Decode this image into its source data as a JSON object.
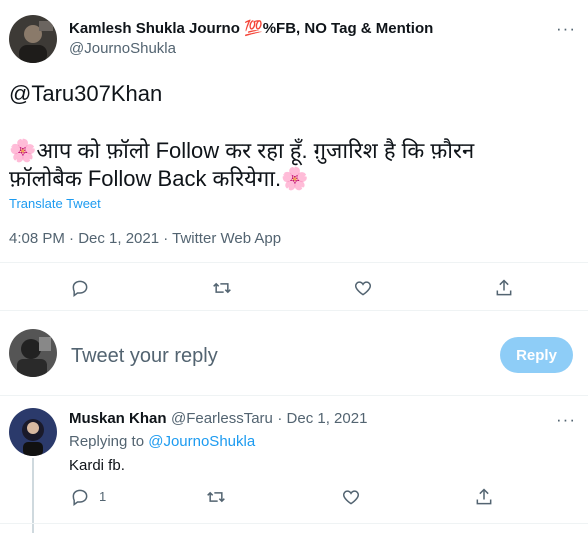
{
  "tweet": {
    "author_name": "Kamlesh Shukla Journo 💯%FB, NO Tag & Mention",
    "author_handle": "@JournoShukla",
    "more_label": "···",
    "mention": "@Taru307Khan",
    "line1": "🌸आप को फ़ॉलो Follow कर रहा हूँ. ग़ुजारिश है कि फ़ौरन",
    "line2": "फ़ॉलोबैक Follow Back करियेगा.🌸",
    "translate_label": "Translate Tweet",
    "timestamp": "4:08 PM · Dec 1, 2021 · Twitter Web App"
  },
  "actions": {
    "icons": [
      "reply-icon",
      "retweet-icon",
      "like-icon",
      "share-icon"
    ]
  },
  "composer": {
    "placeholder": "Tweet your reply",
    "reply_button": "Reply"
  },
  "reply": {
    "author_name": "Muskan Khan",
    "author_handle": "@FearlessTaru",
    "date": "· Dec 1, 2021",
    "more_label": "···",
    "replying_to_label": "Replying to",
    "replying_to_handle": "@JournoShukla",
    "text": "Kardi fb.",
    "reply_count": "1"
  },
  "colors": {
    "accent": "#1d9bf0",
    "reply_button_disabled": "#8ecdf7",
    "secondary_text": "#536471"
  }
}
